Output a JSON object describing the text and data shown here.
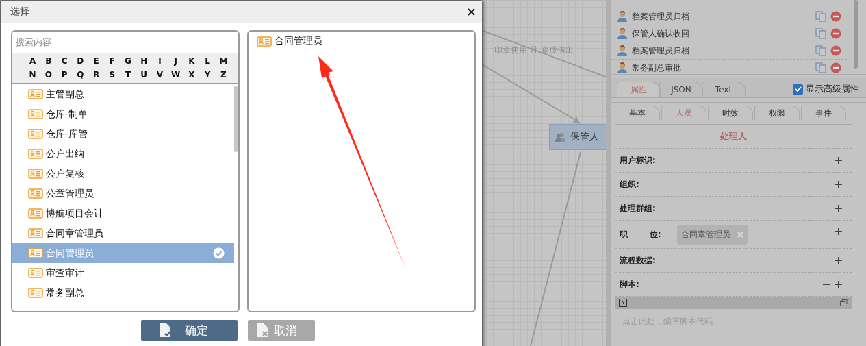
{
  "canvas": {
    "edge_label": "印章使用 且 资质借出",
    "node": {
      "label": "保管人"
    }
  },
  "dialog": {
    "title": "选择",
    "search": {
      "placeholder": "搜索内容"
    },
    "letters": [
      "A",
      "B",
      "C",
      "D",
      "E",
      "F",
      "G",
      "H",
      "I",
      "J",
      "K",
      "L",
      "M",
      "N",
      "O",
      "P",
      "Q",
      "R",
      "S",
      "T",
      "U",
      "V",
      "W",
      "X",
      "Y",
      "Z"
    ],
    "options": [
      {
        "label": "主管副总",
        "selected": false
      },
      {
        "label": "仓库-制单",
        "selected": false
      },
      {
        "label": "仓库-库管",
        "selected": false
      },
      {
        "label": "公户出纳",
        "selected": false
      },
      {
        "label": "公户复核",
        "selected": false
      },
      {
        "label": "公章管理员",
        "selected": false
      },
      {
        "label": "博航项目会计",
        "selected": false
      },
      {
        "label": "合同章管理员",
        "selected": false
      },
      {
        "label": "合同管理员",
        "selected": true
      },
      {
        "label": "审查审计",
        "selected": false
      },
      {
        "label": "常务副总",
        "selected": false
      }
    ],
    "chosen": [
      {
        "label": "合同管理员"
      }
    ],
    "buttons": [
      {
        "label": "确定",
        "kind": "confirm"
      },
      {
        "label": "取消",
        "kind": "cancel"
      }
    ]
  },
  "panel": {
    "steps": [
      {
        "label": "档案管理员归档"
      },
      {
        "label": "保管人确认收回"
      },
      {
        "label": "档案管理员归档"
      },
      {
        "label": "常务副总审批"
      }
    ],
    "tabs": [
      {
        "label": "属性",
        "selected": true
      },
      {
        "label": "JSON",
        "selected": false
      },
      {
        "label": "Text",
        "selected": false
      }
    ],
    "advanced": {
      "label": "显示高级属性",
      "checked": true
    },
    "sub_tabs": [
      {
        "label": "基本",
        "selected": false
      },
      {
        "label": "人员",
        "selected": true
      },
      {
        "label": "时效",
        "selected": false
      },
      {
        "label": "权限",
        "selected": false
      },
      {
        "label": "事件",
        "selected": false
      }
    ],
    "section_title": "处理人",
    "fields": [
      {
        "label": "用户标识:",
        "kind": "plain"
      },
      {
        "label": "组织:",
        "kind": "plain"
      },
      {
        "label": "处理群组:",
        "kind": "plain"
      },
      {
        "label": "职 位:",
        "kind": "tags",
        "tags": [
          "合同章管理员"
        ]
      },
      {
        "label": "流程数据:",
        "kind": "plain"
      },
      {
        "label": "脚本:",
        "kind": "script"
      }
    ],
    "script": {
      "placeholder": "点击此处，编写脚本代码"
    }
  }
}
